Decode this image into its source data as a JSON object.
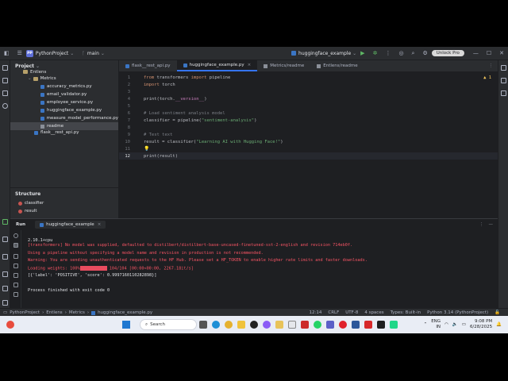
{
  "titlebar": {
    "project_badge": "PP",
    "project": "PythonProject",
    "branch": "main",
    "run_config": "huggingface_example",
    "unlock": "Unlock Pro"
  },
  "project_panel": {
    "title": "Project",
    "items": [
      {
        "label": "Entlens",
        "type": "folder"
      },
      {
        "label": "Metrics",
        "type": "folder"
      },
      {
        "label": "accuracy_metrics.py",
        "type": "py"
      },
      {
        "label": "email_validator.py",
        "type": "py"
      },
      {
        "label": "employee_service.py",
        "type": "py"
      },
      {
        "label": "huggingface_example.py",
        "type": "py"
      },
      {
        "label": "measure_model_performance.py",
        "type": "py"
      },
      {
        "label": "readme",
        "type": "md"
      },
      {
        "label": "flask__rest_api.py",
        "type": "py"
      }
    ]
  },
  "structure_panel": {
    "title": "Structure",
    "items": [
      "classifier",
      "result"
    ]
  },
  "editor": {
    "tabs": [
      {
        "label": "flask__rest_api.py",
        "active": false
      },
      {
        "label": "huggingface_example.py",
        "active": true
      },
      {
        "label": "Metrics/readme",
        "active": false
      },
      {
        "label": "Entlens/readme",
        "active": false
      }
    ],
    "warning_count": "1",
    "lines": [
      {
        "n": "1",
        "code": "from transformers import pipeline"
      },
      {
        "n": "2",
        "code": "import torch"
      },
      {
        "n": "3",
        "code": ""
      },
      {
        "n": "4",
        "code": "print(torch.__version__)"
      },
      {
        "n": "5",
        "code": ""
      },
      {
        "n": "6",
        "code": "# Load sentiment analysis model"
      },
      {
        "n": "7",
        "code": "classifier = pipeline(\"sentiment-analysis\")"
      },
      {
        "n": "8",
        "code": ""
      },
      {
        "n": "9",
        "code": "# Test text"
      },
      {
        "n": "10",
        "code": "result = classifier(\"Learning AI with Hugging Face!\")"
      },
      {
        "n": "11",
        "code": ""
      },
      {
        "n": "12",
        "code": "print(result)"
      }
    ]
  },
  "run_panel": {
    "title": "Run",
    "tab": "huggingface_example",
    "console": [
      {
        "text": "2.10.1+cpu",
        "kind": "out"
      },
      {
        "text": "[transformers] No model was supplied, defaulted to distilbert/distilbert-base-uncased-finetuned-sst-2-english and revision 714eb0f.",
        "kind": "err"
      },
      {
        "text": "Using a pipeline without specifying a model name and revision in production is not recommended.",
        "kind": "err"
      },
      {
        "text": "Warning: You are sending unauthenticated requests to the HF Hub. Please set a HF_TOKEN to enable higher rate limits and faster downloads.",
        "kind": "err"
      },
      {
        "text": "Loading weights: 100%",
        "kind": "err",
        "suffix": " 104/104 [00:00<00:00, 2267.18it/s]"
      },
      {
        "text": "[{'label': 'POSITIVE', 'score': 0.9997160110282898}]",
        "kind": "out"
      },
      {
        "text": "",
        "kind": "out"
      },
      {
        "text": "Process finished with exit code 0",
        "kind": "out"
      }
    ]
  },
  "statusbar": {
    "breadcrumbs": [
      "PythonProject",
      "Entlens",
      "Metrics",
      "huggingface_example.py"
    ],
    "position": "12:14",
    "line_sep": "CRLF",
    "encoding": "UTF-8",
    "indent": "4 spaces",
    "types": "Types: Built-in",
    "interpreter": "Python 3.14 (PythonProject)"
  },
  "taskbar": {
    "search_placeholder": "Search",
    "lang": "ENG",
    "region": "IN",
    "time": "9:08 PM",
    "date": "6/28/2025"
  }
}
